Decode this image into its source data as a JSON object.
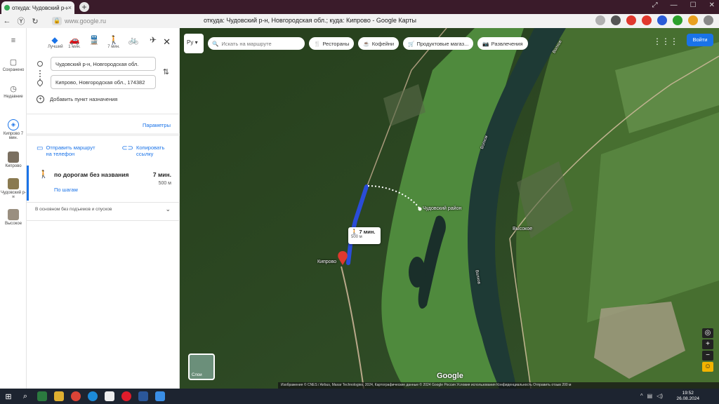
{
  "browser": {
    "tab_title": "откуда: Чудовский р-н",
    "tab_close": "×",
    "new_tab": "+",
    "url": "www.google.ru",
    "page_title": "откуда: Чудовский р-н, Новгородская обл.; куда: Кипрово - Google Карты",
    "window_controls": [
      "⤢",
      "—",
      "☐",
      "✕"
    ]
  },
  "rail": {
    "menu_icon": "≡",
    "items": [
      {
        "label": "Сохранено",
        "icon": "bookmark-icon"
      },
      {
        "label": "Недавние",
        "icon": "history-icon"
      },
      {
        "label": "Кипрово 7 мин.",
        "icon": "route-icon"
      },
      {
        "label": "Кипрово",
        "icon": "place-thumb"
      },
      {
        "label": "Чудовский р-н",
        "icon": "place-thumb"
      },
      {
        "label": "Высокое",
        "icon": "place-thumb"
      }
    ]
  },
  "directions": {
    "modes": [
      {
        "label": "Лучший",
        "icon": "◆",
        "active": true
      },
      {
        "label": "1 мин.",
        "icon": "🚗",
        "active": false
      },
      {
        "label": "",
        "icon": "🚆",
        "active": false
      },
      {
        "label": "7 мин.",
        "icon": "🚶",
        "active": false
      },
      {
        "label": "",
        "icon": "🚲",
        "active": false
      },
      {
        "label": "",
        "icon": "✈",
        "active": false
      }
    ],
    "close": "✕",
    "origin": "Чудовский р-н, Новгородская обл.",
    "destination": "Кипрово, Новгородская обл., 174382",
    "swap_icon": "⇅",
    "add_stop": "Добавить пункт назначения",
    "params": "Параметры",
    "send_to_phone": "Отправить маршрут на телефон",
    "copy_link": "Копировать ссылку",
    "route": {
      "name": "по дорогам без названия",
      "time": "7 мин.",
      "distance": "500 м",
      "steps": "По шагам"
    },
    "terrain_note": "В основном без подъемов и спусков"
  },
  "map": {
    "lang": "Ру",
    "search_placeholder": "Искать на маршруте",
    "chips": [
      {
        "label": "Рестораны",
        "icon": "🍴"
      },
      {
        "label": "Кофейни",
        "icon": "☕"
      },
      {
        "label": "Продуктовые магаз...",
        "icon": "🛒"
      },
      {
        "label": "Развлечения",
        "icon": "📷"
      }
    ],
    "signin": "Войти",
    "labels": {
      "chudovsky": "Чудовский район",
      "vysokoe": "Высокое",
      "kiprovo": "Кипрово",
      "volkhov1": "Волхов",
      "volkhov2": "Волхов",
      "volkhov3": "Волхов"
    },
    "callout_time": "7 мин.",
    "callout_dist": "500 м",
    "layers": "Слои",
    "google": "Google",
    "attribution": "Изображения © CNES / Airbus, Maxar Technologies, 2024, Картографические данные © 2024 Google  Россия  Условия использования  Конфиденциальность  Отправить отзыв  200 м"
  },
  "taskbar": {
    "time": "19:52",
    "date": "26.08.2024"
  }
}
